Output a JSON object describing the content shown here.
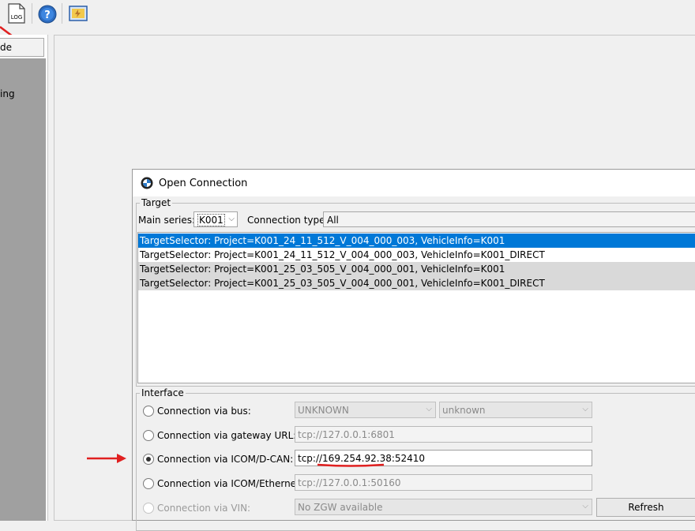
{
  "toolbar": {
    "log_label": "LOG"
  },
  "left_panel": {
    "tab_label": "de",
    "item_label": "ing"
  },
  "dialog": {
    "title": "Open Connection",
    "target": {
      "legend": "Target",
      "main_series_label": "Main series:",
      "main_series_value": "K001",
      "connection_type_label": "Connection type:",
      "connection_type_value": "All",
      "selectors": [
        "TargetSelector: Project=K001_24_11_512_V_004_000_003, VehicleInfo=K001",
        "TargetSelector: Project=K001_24_11_512_V_004_000_003, VehicleInfo=K001_DIRECT",
        "TargetSelector: Project=K001_25_03_505_V_004_000_001, VehicleInfo=K001",
        "TargetSelector: Project=K001_25_03_505_V_004_000_001, VehicleInfo=K001_DIRECT"
      ]
    },
    "interface": {
      "legend": "Interface",
      "bus_label": "Connection via bus:",
      "bus_value1": "UNKNOWN",
      "bus_value2": "unknown",
      "gateway_label": "Connection via gateway URL:",
      "gateway_value": "tcp://127.0.0.1:6801",
      "icom_dcan_label": "Connection via ICOM/D-CAN:",
      "icom_dcan_value": "tcp://169.254.92.38:52410",
      "icom_eth_label": "Connection via ICOM/Ethernet:",
      "icom_eth_value": "tcp://127.0.0.1:50160",
      "vin_label": "Connection via VIN:",
      "vin_value": "No ZGW available",
      "refresh_label": "Refresh"
    }
  },
  "colors": {
    "selection": "#0078d7",
    "alt_row": "#d9d9d9",
    "annotation_red": "#e02020"
  }
}
